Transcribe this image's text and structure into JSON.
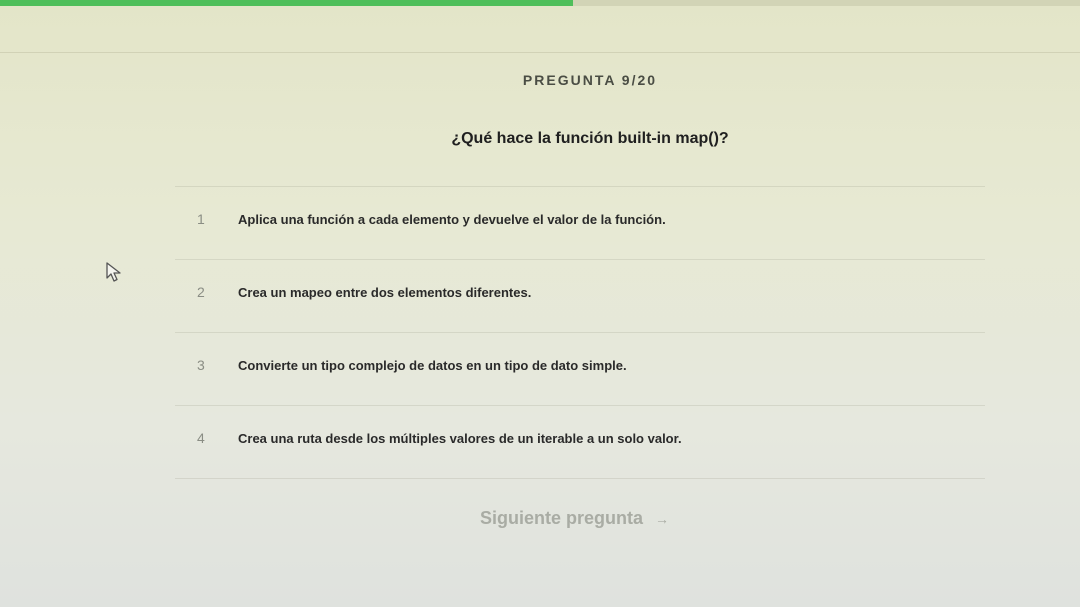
{
  "progress": {
    "current": 9,
    "total": 20,
    "fill_color": "#4fbf5a"
  },
  "header": {
    "counter_label": "PREGUNTA 9/20"
  },
  "question": {
    "text": "¿Qué hace la función built-in map()?"
  },
  "options": [
    {
      "number": "1",
      "text": "Aplica una función a cada elemento y devuelve el valor de la función."
    },
    {
      "number": "2",
      "text": "Crea un mapeo entre dos elementos diferentes."
    },
    {
      "number": "3",
      "text": "Convierte un tipo complejo de datos en un tipo de dato simple."
    },
    {
      "number": "4",
      "text": "Crea una ruta desde los múltiples valores de un iterable a un solo valor."
    }
  ],
  "footer": {
    "next_label": "Siguiente pregunta",
    "next_icon": "arrow-right-icon"
  },
  "cursor": {
    "icon": "mouse-pointer-icon"
  }
}
